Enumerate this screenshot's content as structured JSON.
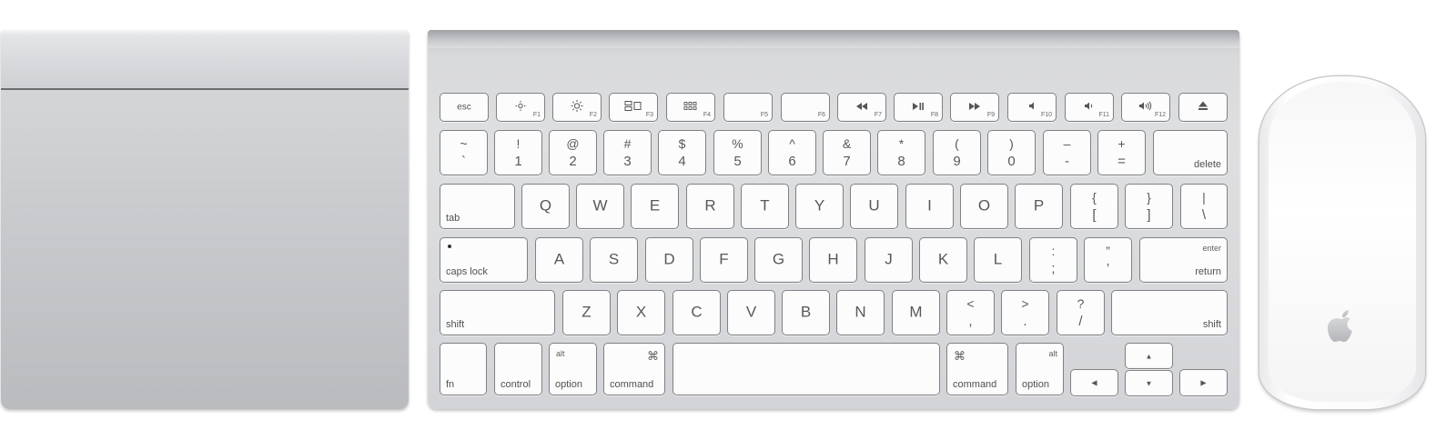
{
  "trackpad": {},
  "keyboard": {
    "row_fn": {
      "esc": "esc",
      "f1": "F1",
      "f2": "F2",
      "f3": "F3",
      "f4": "F4",
      "f5": "F5",
      "f6": "F6",
      "f7": "F7",
      "f8": "F8",
      "f9": "F9",
      "f10": "F10",
      "f11": "F11",
      "f12": "F12",
      "icons": {
        "f1": "brightness-down-icon",
        "f2": "brightness-up-icon",
        "f3": "mission-control-icon",
        "f4": "dashboard-icon",
        "f7": "rewind-icon",
        "f8": "play-pause-icon",
        "f9": "fast-forward-icon",
        "f10": "mute-icon",
        "f11": "volume-down-icon",
        "f12": "volume-up-icon",
        "eject": "eject-icon"
      }
    },
    "row_num": {
      "tilde_top": "~",
      "tilde_bot": "`",
      "k1_top": "!",
      "k1_bot": "1",
      "k2_top": "@",
      "k2_bot": "2",
      "k3_top": "#",
      "k3_bot": "3",
      "k4_top": "$",
      "k4_bot": "4",
      "k5_top": "%",
      "k5_bot": "5",
      "k6_top": "^",
      "k6_bot": "6",
      "k7_top": "&",
      "k7_bot": "7",
      "k8_top": "*",
      "k8_bot": "8",
      "k9_top": "(",
      "k9_bot": "9",
      "k0_top": ")",
      "k0_bot": "0",
      "minus_top": "–",
      "minus_bot": "-",
      "equal_top": "+",
      "equal_bot": "=",
      "delete": "delete"
    },
    "row_q": {
      "tab": "tab",
      "letters": [
        "Q",
        "W",
        "E",
        "R",
        "T",
        "Y",
        "U",
        "I",
        "O",
        "P"
      ],
      "lbrace_top": "{",
      "lbrace_bot": "[",
      "rbrace_top": "}",
      "rbrace_bot": "]",
      "pipe_top": "|",
      "pipe_bot": "\\"
    },
    "row_a": {
      "caps": "caps lock",
      "letters": [
        "A",
        "S",
        "D",
        "F",
        "G",
        "H",
        "J",
        "K",
        "L"
      ],
      "colon_top": ":",
      "colon_bot": ";",
      "quote_top": "”",
      "quote_bot": "’",
      "enter": "enter",
      "return": "return"
    },
    "row_z": {
      "shift_l": "shift",
      "letters": [
        "Z",
        "X",
        "C",
        "V",
        "B",
        "N",
        "M"
      ],
      "lt_top": "<",
      "lt_bot": ",",
      "gt_top": ">",
      "gt_bot": ".",
      "q_top": "?",
      "q_bot": "/",
      "shift_r": "shift"
    },
    "row_bottom": {
      "fn": "fn",
      "control": "control",
      "alt": "alt",
      "option": "option",
      "cmd_symbol": "⌘",
      "command": "command",
      "arrow_up": "▲",
      "arrow_down": "▼",
      "arrow_left": "◀",
      "arrow_right": "▶"
    }
  },
  "mouse": {
    "logo": "apple-logo-icon"
  }
}
